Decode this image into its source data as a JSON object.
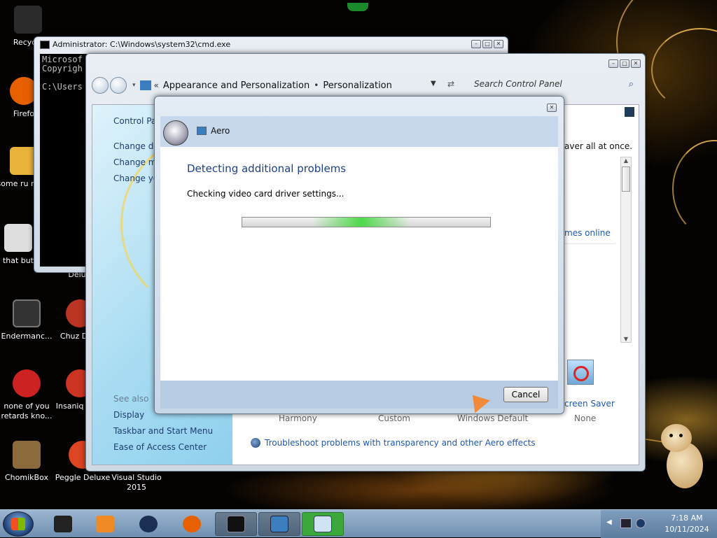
{
  "desktop": {
    "icons": [
      {
        "label": "Recycle",
        "color": "#2b2b2b"
      },
      {
        "label": "Firefo",
        "color": "#e66000"
      },
      {
        "label": "some ru ran a",
        "color": "#e8b23a"
      },
      {
        "label": "that but",
        "color": "#dddddd"
      },
      {
        "label": "Endermanc...",
        "color": "#333333"
      },
      {
        "label": "none of you retards kno...",
        "color": "#cc2222"
      },
      {
        "label": "ChomikBox",
        "color": "#8a6a3a"
      },
      {
        "label": "Delu",
        "color": "#aa3322"
      },
      {
        "label": "Chuz Delu",
        "color": "#bb3322"
      },
      {
        "label": "Insaniq Delu",
        "color": "#cc3322"
      },
      {
        "label": "Peggle Deluxe",
        "color": "#dd4422"
      },
      {
        "label": "Visual Studio 2015",
        "color": "#68217a"
      }
    ]
  },
  "cmd": {
    "title": "Administrator: C:\\Windows\\system32\\cmd.exe",
    "lines": [
      "Microsof",
      "Copyrigh",
      "",
      "C:\\Users"
    ]
  },
  "cp": {
    "breadcrumb": [
      "Appearance and Personalization",
      "Personalization"
    ],
    "search_placeholder": "Search Control Panel",
    "sidebar": {
      "home": "Control Par",
      "links": [
        "Change des",
        "Change mo",
        "Change you"
      ],
      "see_also": "See also",
      "see_also_links": [
        "Display",
        "Taskbar and Start Menu",
        "Ease of Access Center"
      ]
    },
    "main": {
      "partial_text": "aver all at once.",
      "themes_online": "mes online",
      "screen_saver": "creen Saver",
      "themes": [
        "Harmony",
        "Custom",
        "Windows Default",
        "None"
      ],
      "troubleshoot": "Troubleshoot problems with transparency and other Aero effects"
    }
  },
  "aero": {
    "header_title": "Aero",
    "heading": "Detecting additional problems",
    "status": "Checking video card driver settings...",
    "cancel": "Cancel"
  },
  "taskbar": {
    "time": "7:18 AM",
    "date": "10/11/2024"
  }
}
